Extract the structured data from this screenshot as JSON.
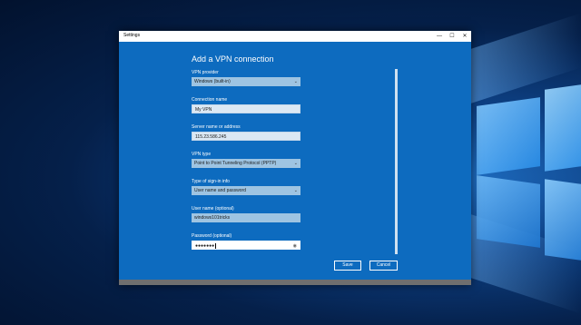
{
  "window": {
    "title": "Settings",
    "minimize_glyph": "—",
    "maximize_glyph": "☐",
    "close_glyph": "✕"
  },
  "dialog": {
    "heading": "Add a VPN connection",
    "fields": {
      "vpn_provider": {
        "label": "VPN provider",
        "value": "Windows (built-in)"
      },
      "connection_name": {
        "label": "Connection name",
        "value": "My VPN"
      },
      "server": {
        "label": "Server name or address",
        "value": "115.23.586.245"
      },
      "vpn_type": {
        "label": "VPN type",
        "value": "Point to Point Tunneling Protocol (PPTP)"
      },
      "sign_in_type": {
        "label": "Type of sign-in info",
        "value": "User name and password"
      },
      "username": {
        "label": "User name (optional)",
        "value": "windows101tricks"
      },
      "password": {
        "label": "Password (optional)",
        "value": "●●●●●●●"
      }
    },
    "buttons": {
      "save": "Save",
      "cancel": "Cancel"
    }
  },
  "icons": {
    "chevron": "chevron-down-icon",
    "reveal": "eye-icon"
  },
  "colors": {
    "dialog_bg": "#0d6bbf",
    "desktop_bg": "#02122e",
    "accent": "#1f6fc4"
  }
}
